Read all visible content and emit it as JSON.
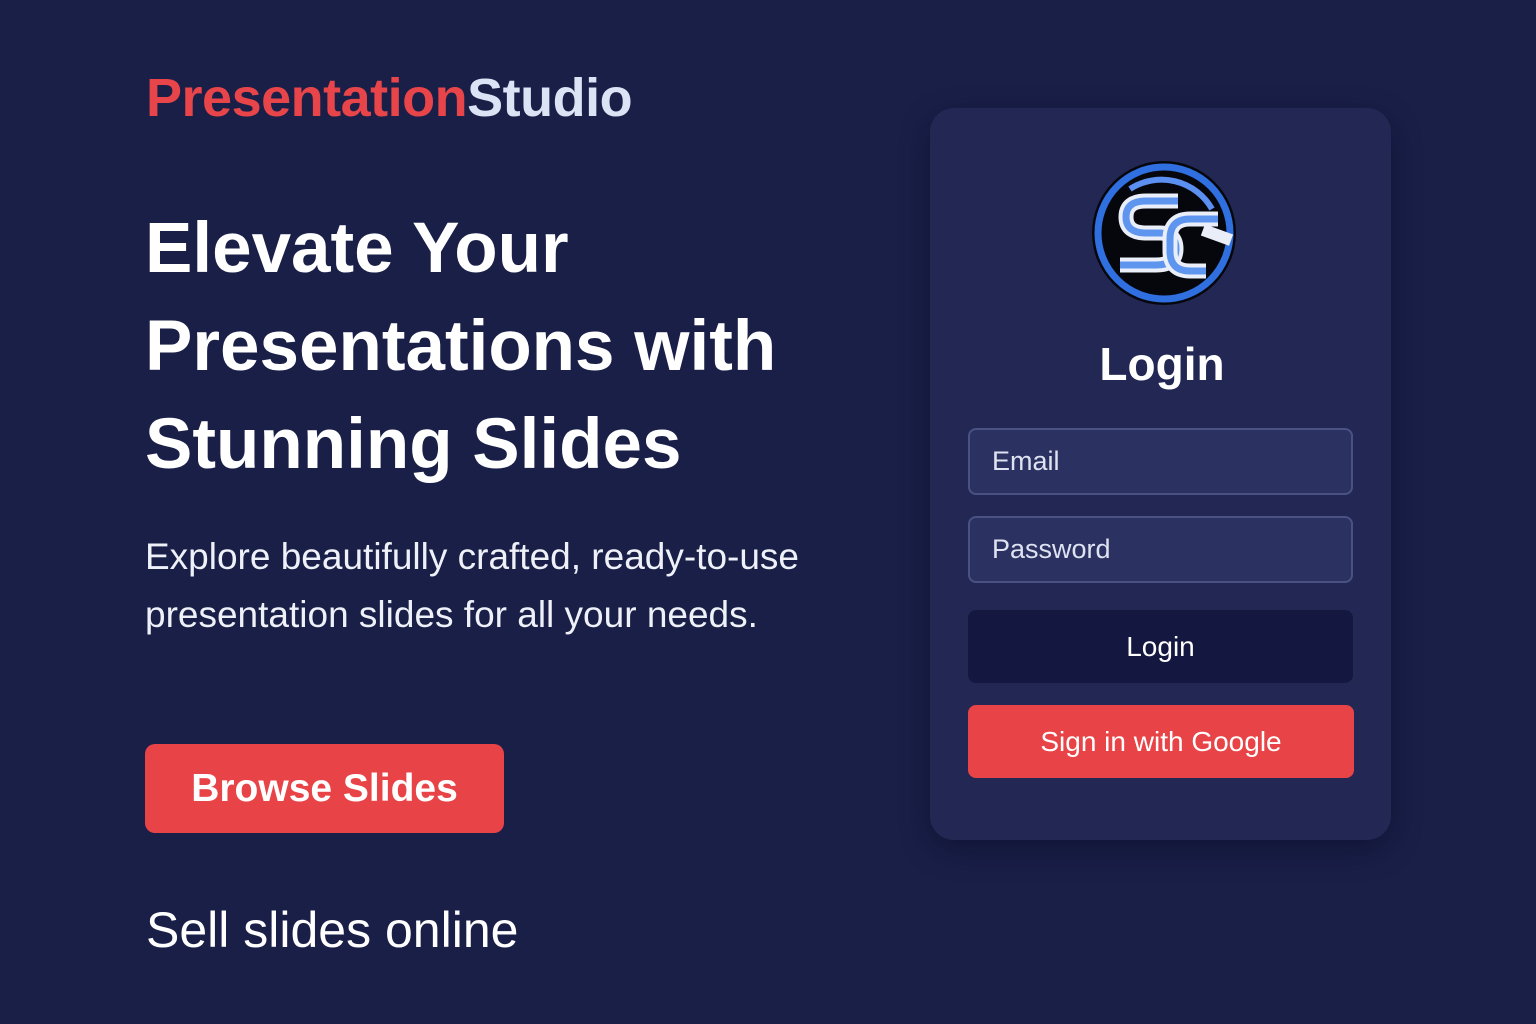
{
  "brand": {
    "part1": "Presentation",
    "part2": "Studio",
    "accent_color": "#e8454a",
    "secondary_color": "#dbe3f4"
  },
  "hero": {
    "title": "Elevate Your Presentations with Stunning Slides",
    "subtitle": "Explore beautifully crafted, ready-to-use presentation slides for all your needs.",
    "browse_label": "Browse Slides",
    "tagline": "Sell slides online"
  },
  "login": {
    "logo_icon": "sc-logo-icon",
    "logo_text": "SC",
    "title": "Login",
    "email_placeholder": "Email",
    "password_placeholder": "Password",
    "login_label": "Login",
    "google_label": "Sign in with Google"
  },
  "colors": {
    "background": "#1a1f48",
    "card": "#222853",
    "primary_red": "#e84447",
    "dark_button": "#141840"
  }
}
